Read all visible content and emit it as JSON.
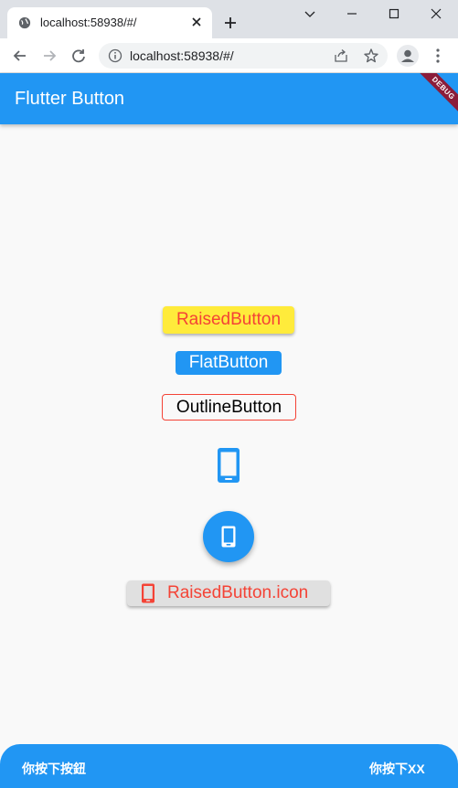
{
  "browser": {
    "tab_title": "localhost:58938/#/",
    "url": "localhost:58938/#/"
  },
  "app": {
    "title": "Flutter Button",
    "debug_banner": "DEBUG"
  },
  "buttons": {
    "raised": "RaisedButton",
    "flat": "FlatButton",
    "outline": "OutlineButton",
    "raised_icon": "RaisedButton.icon"
  },
  "icons": {
    "icon_button": "phone-android-icon",
    "fab": "phone-android-icon",
    "raised_icon": "phone-android-icon"
  },
  "bottom": {
    "left": "你按下按鈕",
    "right": "你按下XX"
  },
  "colors": {
    "primary": "#2196f3",
    "raised_bg": "#ffeb3b",
    "accent_red": "#f44336",
    "grey_button": "#e0e0e0"
  }
}
